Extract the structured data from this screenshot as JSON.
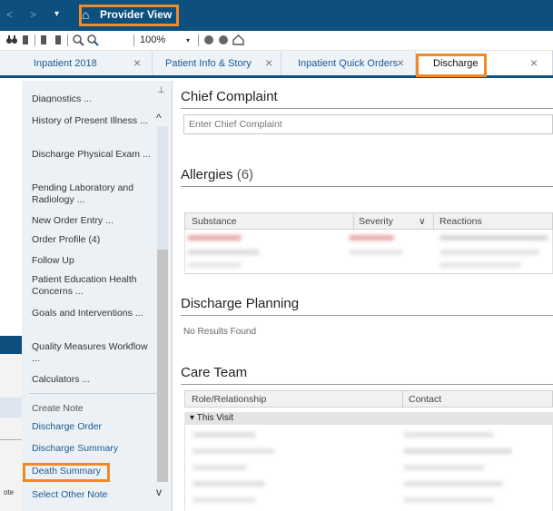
{
  "window": {
    "title": "Provider View",
    "nav_back": "<",
    "nav_forward": ">",
    "nav_dropdown": "▾",
    "home": "⌂"
  },
  "toolbar": {
    "zoom": "100%",
    "zoom_dropdown": "▾"
  },
  "tabs": [
    {
      "label": "Inpatient 2018",
      "close": "×"
    },
    {
      "label": "Patient Info & Story",
      "close": "×"
    },
    {
      "label": "Inpatient Quick Orders",
      "close": "×"
    },
    {
      "label": "Discharge",
      "close": "×"
    }
  ],
  "sidebar": {
    "pin": "⊥",
    "scroll_up": "^",
    "scroll_down": "v",
    "items": [
      "Diagnostics ...",
      "History of Present Illness ...",
      "Discharge Physical Exam ...",
      "Pending Laboratory and Radiology ...",
      "New Order Entry ...",
      "Order Profile (4)",
      "Follow Up",
      "Patient Education Health Concerns ...",
      "Goals and Interventions ...",
      "Quality Measures Workflow ...",
      "Calculators ..."
    ],
    "create_note_header": "Create Note",
    "note_links": [
      "Discharge Order",
      "Discharge Summary",
      "Death Summary",
      "Select Other Note"
    ]
  },
  "behind": {
    "text": "ote"
  },
  "main": {
    "chief_complaint": {
      "title": "Chief Complaint",
      "placeholder": "Enter Chief Complaint"
    },
    "allergies": {
      "title": "Allergies",
      "count": "(6)",
      "columns": [
        "Substance",
        "Severity",
        "Reactions"
      ],
      "sort_icon": "∨"
    },
    "discharge_planning": {
      "title": "Discharge Planning",
      "empty": "No Results Found"
    },
    "care_team": {
      "title": "Care Team",
      "columns": [
        "Role/Relationship",
        "Contact"
      ],
      "group": "This Visit",
      "group_toggle": "▾"
    }
  },
  "colors": {
    "titlebar": "#0d4f7d",
    "highlight": "#f08a24",
    "link": "#1b5a93",
    "sidebar_bg": "#ecf1f6"
  }
}
